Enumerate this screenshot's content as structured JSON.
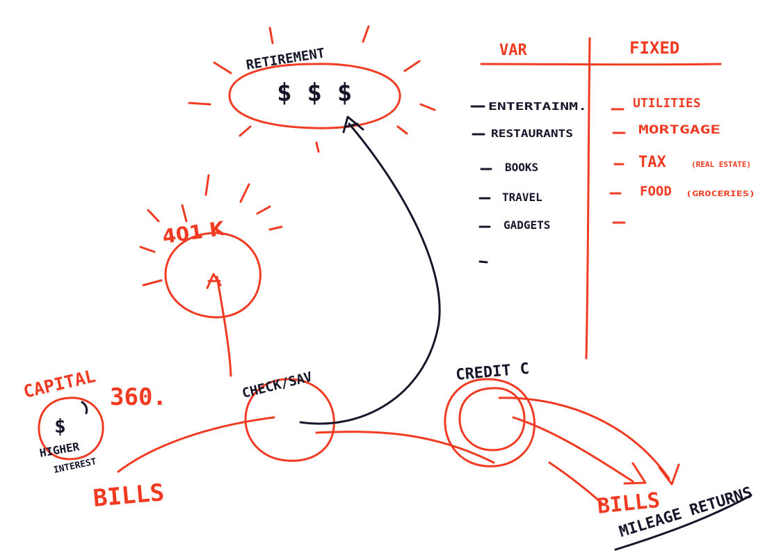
{
  "colors": {
    "red_marker": "#f03a22",
    "black_marker": "#16162a"
  },
  "nodes": {
    "retirement": {
      "label": "RETIREMENT",
      "content": "$ $ $"
    },
    "k401": {
      "label": "401 K"
    },
    "check_sav": {
      "label": "CHECK/SAV"
    },
    "credit_c": {
      "label": "CREDIT C"
    },
    "capital": {
      "label": "CAPITAL",
      "amount": "360.",
      "content": "$",
      "note_line1": "HIGHER",
      "note_line2": "INTEREST"
    }
  },
  "bills_left": "BILLS",
  "bills_right": "BILLS",
  "mileage_returns": "MILEAGE RETURNS",
  "table": {
    "var_header": "VAR",
    "fixed_header": "FIXED",
    "var_items": [
      "ENTERTAINM.",
      "RESTAURANTS",
      "BOOKS",
      "TRAVEL",
      "GADGETS",
      ""
    ],
    "fixed_items": [
      {
        "label": "UTILITIES",
        "note": ""
      },
      {
        "label": "MORTGAGE",
        "note": ""
      },
      {
        "label": "TAX",
        "note": "(REAL ESTATE)"
      },
      {
        "label": "FOOD",
        "note": "(GROCERIES)"
      },
      {
        "label": "",
        "note": ""
      }
    ]
  }
}
